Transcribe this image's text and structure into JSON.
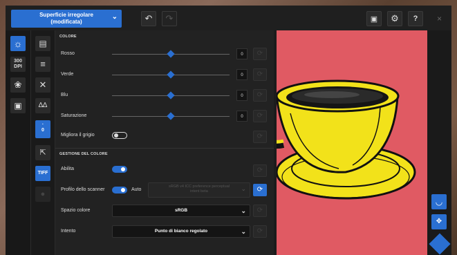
{
  "topbar": {
    "preset_line1": "Superficie irregolare",
    "preset_line2": "(modificata)",
    "undo_icon": "undo-icon",
    "redo_icon": "redo-icon",
    "close": "×"
  },
  "leftbar": {
    "dpi_top": "300",
    "dpi_bottom": "DPI",
    "zero": "0",
    "tiff": "TIFF"
  },
  "colore": {
    "title": "COLORE",
    "sliders": [
      {
        "label": "Rosso",
        "value": "0",
        "fraction": 0.5
      },
      {
        "label": "Verde",
        "value": "0",
        "fraction": 0.5
      },
      {
        "label": "Blu",
        "value": "0",
        "fraction": 0.5
      },
      {
        "label": "Saturazione",
        "value": "0",
        "fraction": 0.5
      }
    ],
    "migliora_label": "Migliora il grigio",
    "migliora_on": false
  },
  "gestione": {
    "title": "GESTIONE DEL COLORE",
    "abilita_label": "Abilita",
    "abilita_on": true,
    "profilo_label": "Profilo dello scanner",
    "profilo_on": true,
    "auto_label": "Auto",
    "profilo_value_line1": "sRGB v4 ICC preference perceptual",
    "profilo_value_line2": "intent beta",
    "spazio_label": "Spazio colore",
    "spazio_value": "sRGB",
    "intento_label": "Intento",
    "intento_value": "Punto di bianco regolato"
  },
  "colors": {
    "accent": "#2a6fd1",
    "preview_bg": "#e05a63",
    "cup_yellow": "#f2e21a"
  }
}
